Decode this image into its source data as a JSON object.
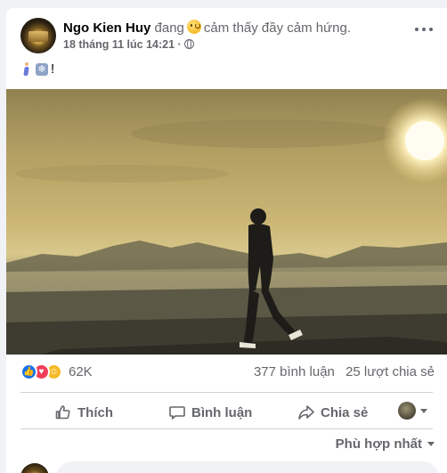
{
  "post": {
    "author": "Ngo Kien Huy",
    "feeling_prefix": "đang",
    "feeling_text": "cảm thấy đầy cảm hứng.",
    "timestamp": "18 tháng 11 lúc 14:21",
    "privacy_icon": "globe-icon",
    "caption_text": "!",
    "caption_emojis": [
      "person-walking-icon",
      "snowflake-icon"
    ]
  },
  "engagement": {
    "reactions": [
      "like",
      "love",
      "care"
    ],
    "reaction_count": "62K",
    "comments": "377 bình luận",
    "shares": "25 lượt chia sẻ"
  },
  "actions": {
    "like": "Thích",
    "comment": "Bình luận",
    "share": "Chia sẻ"
  },
  "comments_section": {
    "sort_label": "Phù hợp nhất"
  },
  "colors": {
    "accent": "#1b74e4",
    "secondary_text": "#65676b",
    "love": "#f33e58",
    "care": "#f7b928"
  }
}
